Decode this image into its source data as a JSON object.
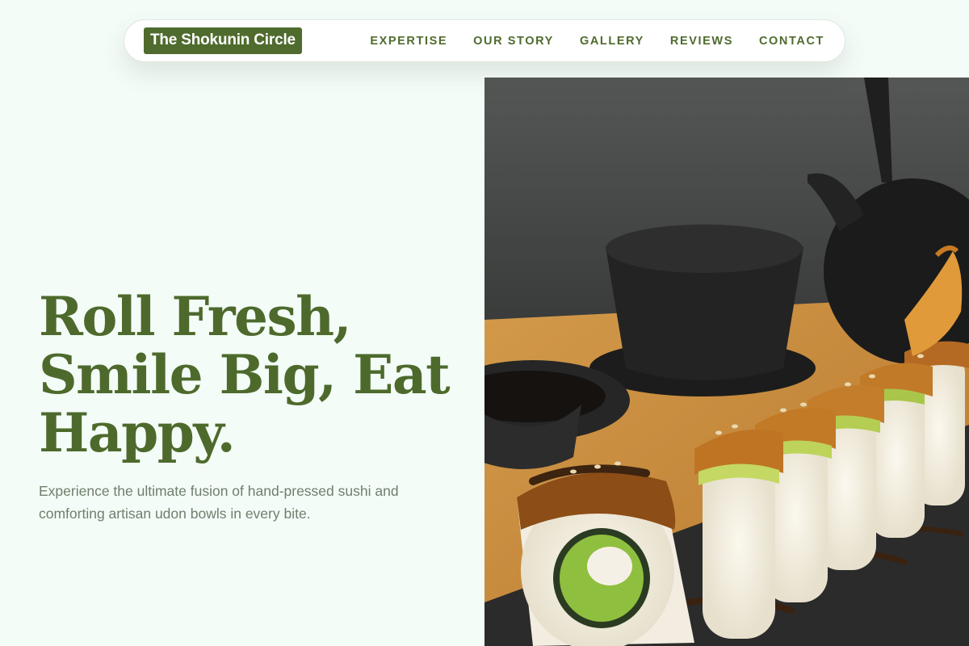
{
  "brand": {
    "name": "The Shokunin Circle"
  },
  "nav": {
    "items": [
      {
        "label": "EXPERTISE"
      },
      {
        "label": "OUR STORY"
      },
      {
        "label": "GALLERY"
      },
      {
        "label": "REVIEWS"
      },
      {
        "label": "CONTACT"
      }
    ]
  },
  "hero": {
    "title_lines": [
      "Roll Fresh,",
      "Smile Big, Eat",
      "Happy."
    ],
    "subtitle": "Experience the ultimate fusion of hand-pressed sushi and comforting artisan udon bowls in every bite.",
    "image_description_icon": "sushi-photo"
  },
  "colors": {
    "accent": "#4f6b2e",
    "background": "#f4fcf7",
    "subtitle": "#6e7f6c"
  }
}
